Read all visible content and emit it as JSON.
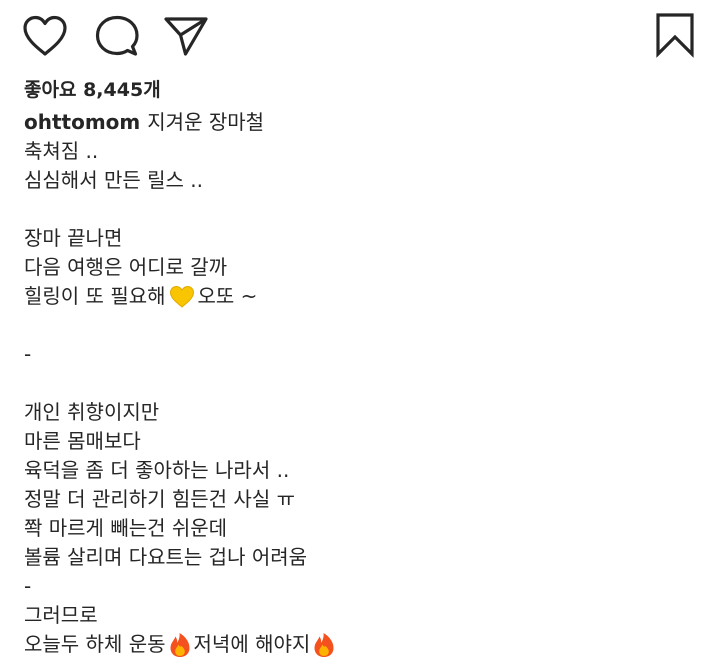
{
  "actions": {
    "like_icon": "heart-icon",
    "comment_icon": "comment-bubble-icon",
    "share_icon": "paper-plane-icon",
    "save_icon": "bookmark-icon"
  },
  "likes": {
    "label": "좋아요",
    "count": "8,445",
    "unit": "개"
  },
  "post": {
    "username": "ohttomom",
    "first_line": "지겨운 장마철",
    "lines": {
      "l2": "축쳐짐 ..",
      "l3": "심심해서 만든 릴스 ..",
      "l5": "장마 끝나면",
      "l6": "다음 여행은 어디로 갈까",
      "l7_before": "힐링이 또 필요해",
      "l7_after": "오또 ~",
      "l9": "-",
      "l11": "개인 취향이지만",
      "l12": "마른 몸매보다",
      "l13": "육덕을 좀 더 좋아하는 나라서 ..",
      "l14": "정말 더 관리하기 힘든건 사실 ㅠ",
      "l15": "쫙 마르게 빼는건 쉬운데",
      "l16": "볼륨 살리며 다요트는 겁나 어려움",
      "l17": "-",
      "l18": "그러므로",
      "l19_a": "오늘두 하체 운동",
      "l19_b": "저녁에 해야지"
    },
    "emojis": {
      "yellow_heart": "yellow-heart-emoji",
      "fire": "fire-emoji"
    },
    "colors": {
      "yellow_heart": "#F9C500",
      "fire_outer": "#F4511E",
      "fire_inner": "#FFB300"
    }
  }
}
